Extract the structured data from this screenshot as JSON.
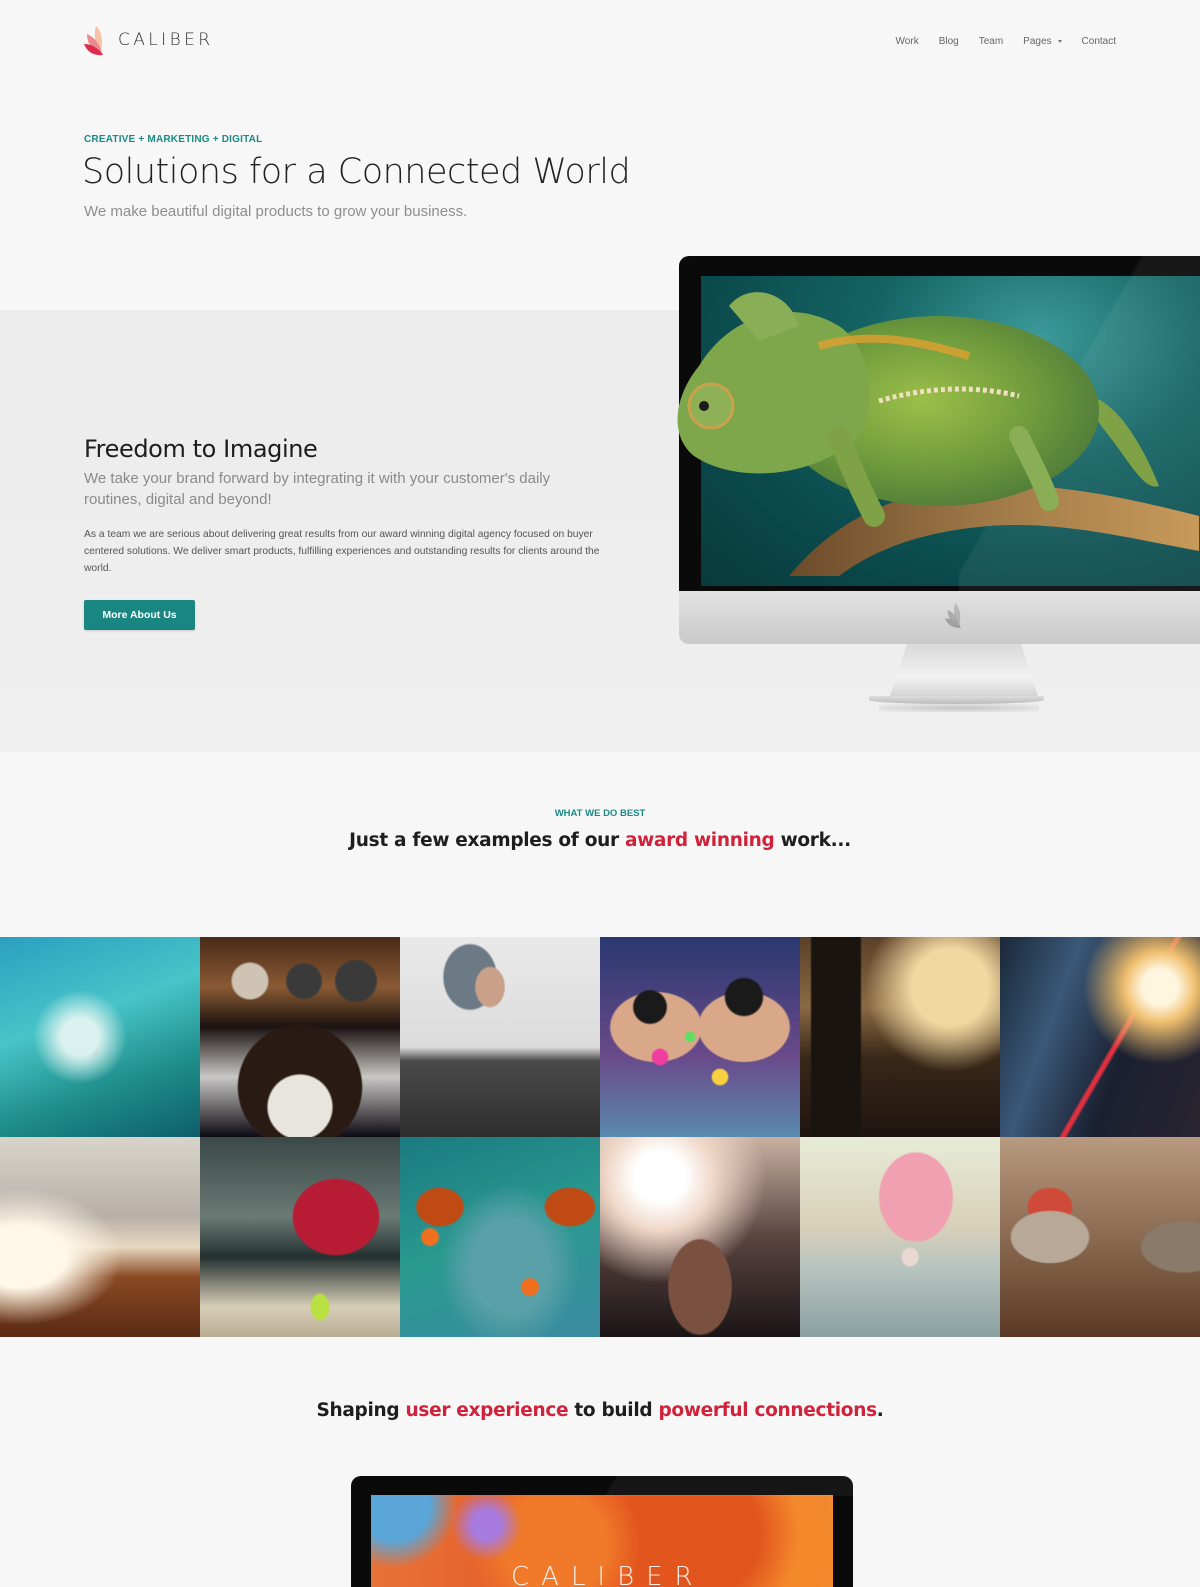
{
  "brand": {
    "name": "CALIBER",
    "logo_icon": "petal-logo-icon",
    "colors": {
      "primary": "#1a8682",
      "accent": "#d0223a",
      "logo": "#e84a5f"
    }
  },
  "nav": {
    "items": [
      {
        "label": "Work"
      },
      {
        "label": "Blog"
      },
      {
        "label": "Team"
      },
      {
        "label": "Pages",
        "has_dropdown": true,
        "icon": "caret-down-icon"
      },
      {
        "label": "Contact"
      }
    ]
  },
  "hero": {
    "eyebrow": "CREATIVE + MARKETING + DIGITAL",
    "title": "Solutions for a Connected World",
    "subtitle": "We make beautiful digital products to grow your business."
  },
  "feature": {
    "title": "Freedom to Imagine",
    "lead": "We take your brand forward by integrating it with your customer's daily routines, digital and beyond!",
    "body": "As a team we are serious about delivering great results from our award winning digital agency focused on buyer centered solutions. We deliver smart products, fulfilling experiences and outstanding results for clients around the world.",
    "button_label": "More About Us",
    "image": "chameleon-on-imac"
  },
  "work": {
    "eyebrow": "WHAT WE DO BEST",
    "title_pre": "Just a few examples of our ",
    "title_accent": "award winning",
    "title_post": " work...",
    "tiles": [
      {
        "subject": "surfer-in-wave"
      },
      {
        "subject": "car-dashboard"
      },
      {
        "subject": "woman-pushup"
      },
      {
        "subject": "confetti-sunglasses"
      },
      {
        "subject": "concert-stage-boots"
      },
      {
        "subject": "city-highway-light-trails"
      },
      {
        "subject": "office-interior"
      },
      {
        "subject": "runner-red-hoodie"
      },
      {
        "subject": "painted-face-glitter"
      },
      {
        "subject": "boxer-backlit"
      },
      {
        "subject": "woman-with-flowers"
      },
      {
        "subject": "toy-robots"
      }
    ]
  },
  "tagline": {
    "pre": "Shaping ",
    "accent1": "user experience",
    "mid": " to build ",
    "accent2": "powerful connections",
    "post": "."
  },
  "showcase": {
    "brand_text": "CALIBER",
    "image": "orange-ink-cloud-on-imac"
  }
}
